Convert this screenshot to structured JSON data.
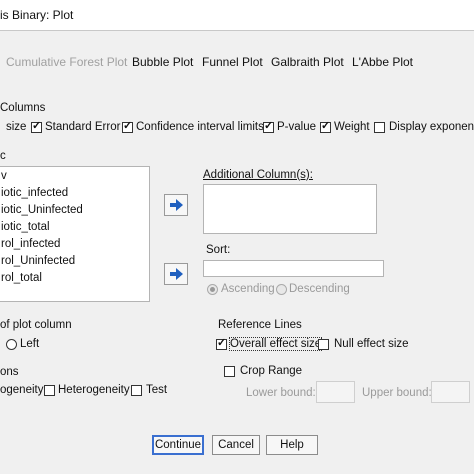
{
  "window": {
    "title": "is Binary:  Plot"
  },
  "tabs": [
    {
      "label": "Cumulative Forest Plot"
    },
    {
      "label": "Bubble Plot"
    },
    {
      "label": "Funnel Plot"
    },
    {
      "label": "Galbraith Plot"
    },
    {
      "label": "L'Abbe Plot"
    }
  ],
  "columns_section": {
    "label": "Columns",
    "items": [
      {
        "label": "size"
      },
      {
        "label": "Standard Error",
        "checked": true
      },
      {
        "label": "Confidence interval limits",
        "checked": true
      },
      {
        "label": "P-value",
        "checked": true
      },
      {
        "label": "Weight",
        "checked": true
      },
      {
        "label": "Display exponent",
        "checked": false
      }
    ]
  },
  "left_list": {
    "label": "c",
    "items": [
      "v",
      "iotic_infected",
      "iotic_Uninfected",
      "iotic_total",
      "rol_infected",
      "rol_Uninfected",
      "rol_total"
    ]
  },
  "additional_columns": {
    "label": "Additional Column(s):"
  },
  "sort": {
    "label": "Sort:",
    "ascending": "Ascending",
    "descending": "Descending"
  },
  "plot_column": {
    "label": "of plot column",
    "left": "Left"
  },
  "reference_lines": {
    "label": "Reference Lines",
    "overall_effect_size": "Overall effect size",
    "overall_checked": true,
    "null_effect_size": "Null effect size",
    "null_checked": false
  },
  "options": {
    "label": "ons",
    "homogeneity": "ogeneity",
    "heterogeneity": "Heterogeneity",
    "test": "Test"
  },
  "crop_range": {
    "label": "Crop Range",
    "lower": "Lower bound:",
    "upper": "Upper bound:"
  },
  "buttons": {
    "continue": "Continue",
    "cancel": "Cancel",
    "help": "Help"
  },
  "colors": {
    "accent": "#3a6fd0",
    "arrow": "#1f5fbf"
  }
}
